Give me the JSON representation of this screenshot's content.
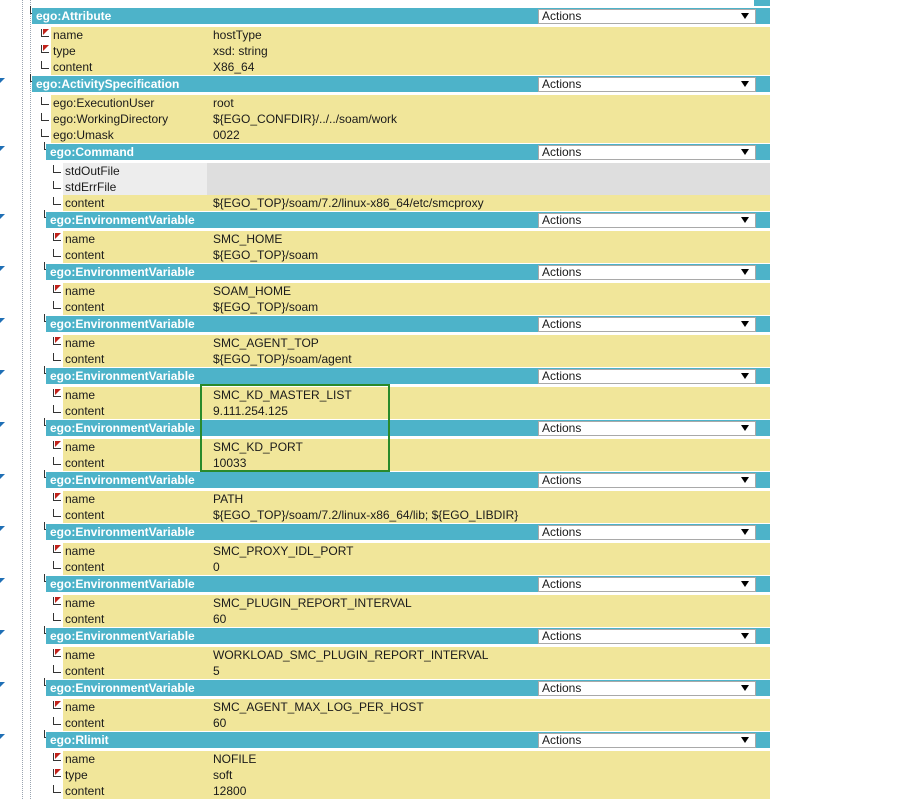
{
  "actions_label": "Actions",
  "sections": [
    {
      "header": "ego:Attribute",
      "rows": [
        {
          "name": "name",
          "value": "hostType"
        },
        {
          "name": "type",
          "value": "xsd: string"
        },
        {
          "name": "content",
          "value": "X86_64"
        }
      ]
    },
    {
      "header": "ego:ActivitySpecification",
      "rows": [
        {
          "name": "ego:ExecutionUser",
          "value": "root"
        },
        {
          "name": "ego:WorkingDirectory",
          "value": "${EGO_CONFDIR}/../../soam/work"
        },
        {
          "name": "ego:Umask",
          "value": "0022"
        }
      ]
    },
    {
      "header": "ego:Command",
      "rows": [
        {
          "name": "stdOutFile",
          "value": ""
        },
        {
          "name": "stdErrFile",
          "value": ""
        },
        {
          "name": "content",
          "value": "${EGO_TOP}/soam/7.2/linux-x86_64/etc/smcproxy"
        }
      ]
    },
    {
      "header": "ego:EnvironmentVariable",
      "rows": [
        {
          "name": "name",
          "value": "SMC_HOME"
        },
        {
          "name": "content",
          "value": "${EGO_TOP}/soam"
        }
      ]
    },
    {
      "header": "ego:EnvironmentVariable",
      "rows": [
        {
          "name": "name",
          "value": "SOAM_HOME"
        },
        {
          "name": "content",
          "value": "${EGO_TOP}/soam"
        }
      ]
    },
    {
      "header": "ego:EnvironmentVariable",
      "rows": [
        {
          "name": "name",
          "value": "SMC_AGENT_TOP"
        },
        {
          "name": "content",
          "value": "${EGO_TOP}/soam/agent"
        }
      ]
    },
    {
      "header": "ego:EnvironmentVariable",
      "rows": [
        {
          "name": "name",
          "value": "SMC_KD_MASTER_LIST"
        },
        {
          "name": "content",
          "value": "9.111.254.125"
        }
      ]
    },
    {
      "header": "ego:EnvironmentVariable",
      "rows": [
        {
          "name": "name",
          "value": "SMC_KD_PORT"
        },
        {
          "name": "content",
          "value": "10033"
        }
      ]
    },
    {
      "header": "ego:EnvironmentVariable",
      "rows": [
        {
          "name": "name",
          "value": "PATH"
        },
        {
          "name": "content",
          "value": "${EGO_TOP}/soam/7.2/linux-x86_64/lib; ${EGO_LIBDIR}"
        }
      ]
    },
    {
      "header": "ego:EnvironmentVariable",
      "rows": [
        {
          "name": "name",
          "value": "SMC_PROXY_IDL_PORT"
        },
        {
          "name": "content",
          "value": "0"
        }
      ]
    },
    {
      "header": "ego:EnvironmentVariable",
      "rows": [
        {
          "name": "name",
          "value": "SMC_PLUGIN_REPORT_INTERVAL"
        },
        {
          "name": "content",
          "value": "60"
        }
      ]
    },
    {
      "header": "ego:EnvironmentVariable",
      "rows": [
        {
          "name": "name",
          "value": "WORKLOAD_SMC_PLUGIN_REPORT_INTERVAL"
        },
        {
          "name": "content",
          "value": "5"
        }
      ]
    },
    {
      "header": "ego:EnvironmentVariable",
      "rows": [
        {
          "name": "name",
          "value": "SMC_AGENT_MAX_LOG_PER_HOST"
        },
        {
          "name": "content",
          "value": "60"
        }
      ]
    },
    {
      "header": "ego:Rlimit",
      "rows": [
        {
          "name": "name",
          "value": "NOFILE"
        },
        {
          "name": "type",
          "value": "soft"
        },
        {
          "name": "content",
          "value": "12800"
        }
      ]
    }
  ]
}
